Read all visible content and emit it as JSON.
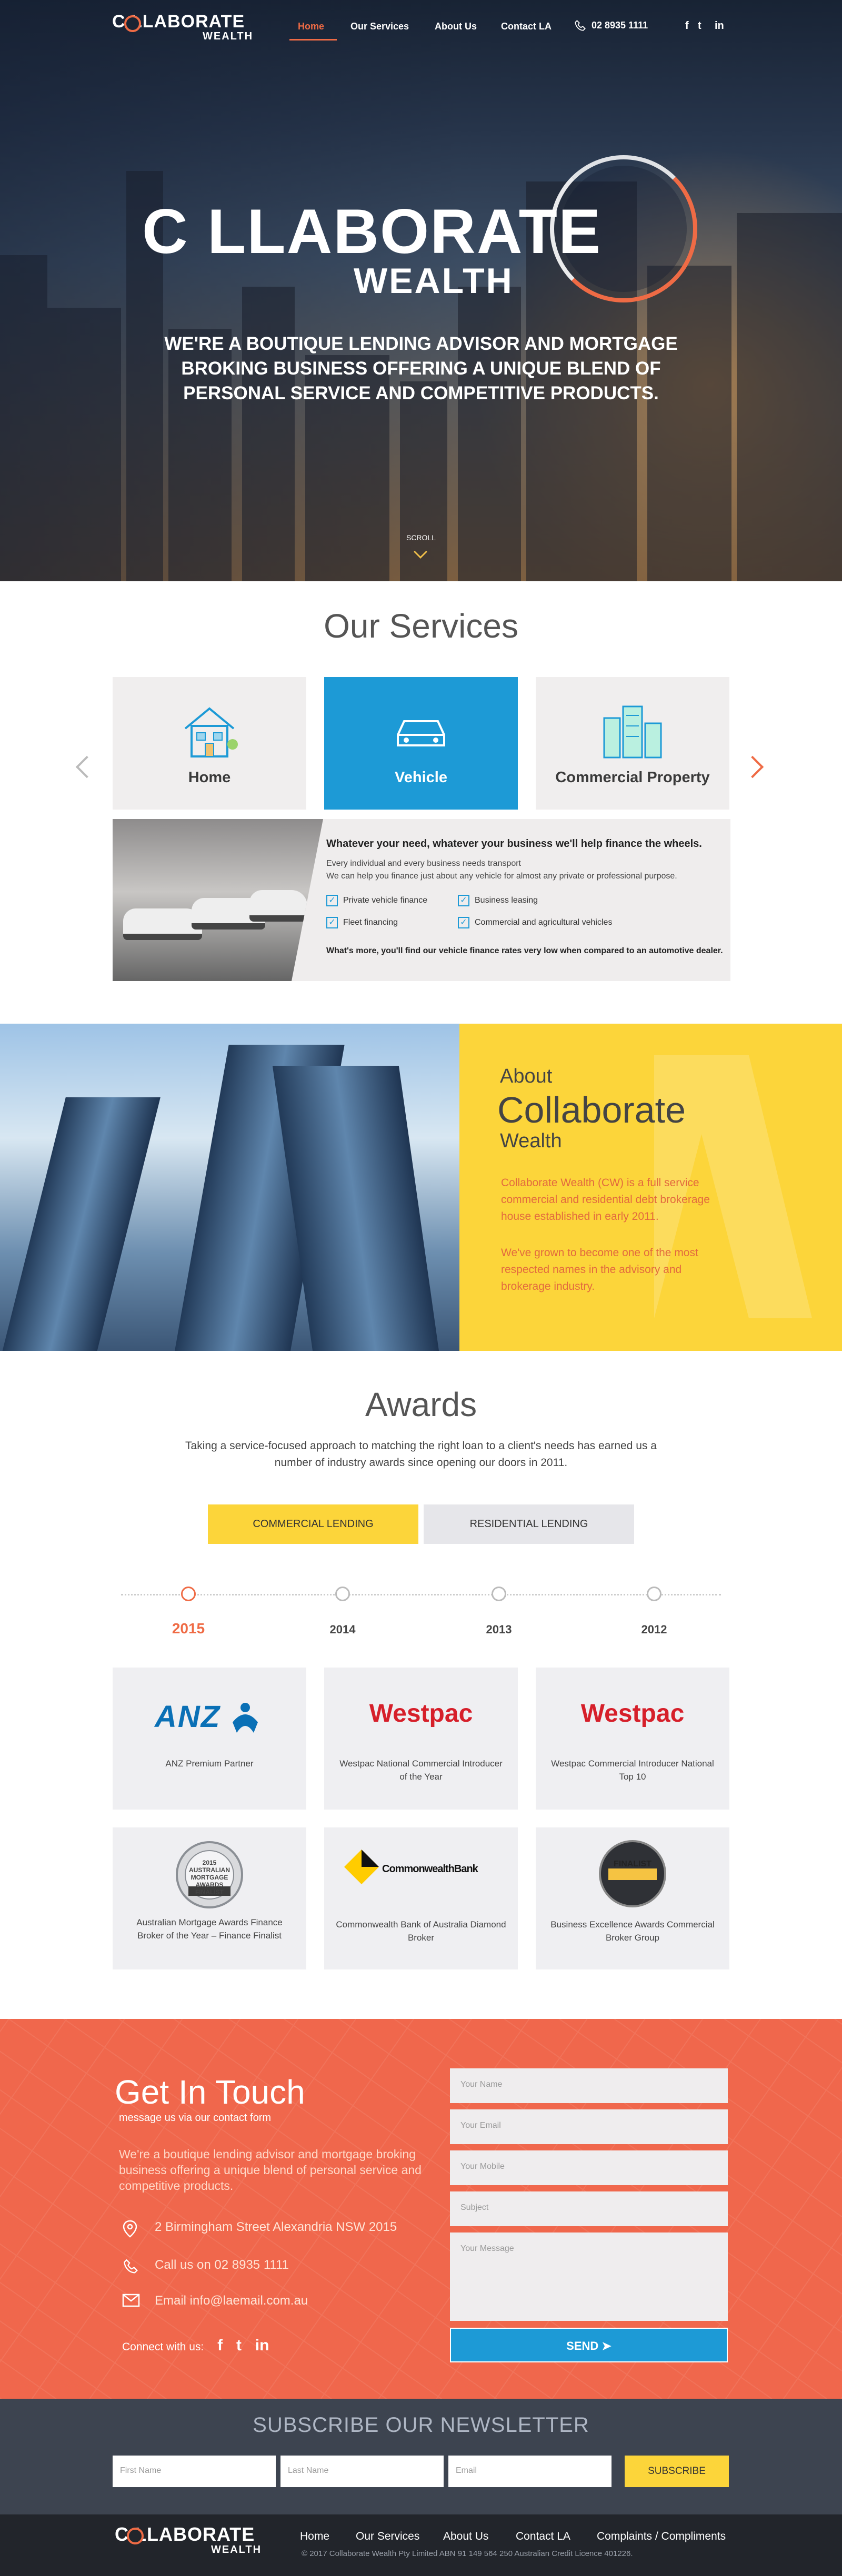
{
  "nav": {
    "logo_big": "C  LLABORATE",
    "logo_small": "WEALTH",
    "links": [
      "Home",
      "Our Services",
      "About Us",
      "Contact LA"
    ],
    "phone": "02 8935 1111",
    "social": [
      "f",
      "t",
      "in"
    ]
  },
  "hero": {
    "logo_big": "C  LLABORATE",
    "logo_small": "WEALTH",
    "tagline": "WE'RE A BOUTIQUE LENDING ADVISOR AND MORTGAGE BROKING BUSINESS OFFERING A UNIQUE BLEND OF PERSONAL SERVICE AND COMPETITIVE PRODUCTS.",
    "scroll": "SCROLL"
  },
  "services": {
    "title": "Our Services",
    "cards": [
      "Home",
      "Vehicle",
      "Commercial Property"
    ],
    "detail": {
      "heading": "Whatever your need, whatever your business we'll help finance the wheels.",
      "line1": "Every individual and every business needs transport",
      "line2": "We can help you finance just about any vehicle for almost any private or professional purpose.",
      "checks": [
        "Private vehicle finance",
        "Business leasing",
        "Fleet financing",
        "Commercial and agricultural vehicles"
      ],
      "footer": "What's more, you'll find our vehicle finance rates very low when compared to an automotive dealer."
    }
  },
  "about": {
    "l1": "About",
    "l2": "Collaborate",
    "l3": "Wealth",
    "p1": "Collaborate Wealth (CW) is a full service commercial and residential debt brokerage house established in early 2011.",
    "p2": "We've grown to become one of the most respected names in the advisory and brokerage industry."
  },
  "awards": {
    "title": "Awards",
    "intro": "Taking a service-focused approach to matching the right loan to a client's needs has earned us a number of industry awards since opening our doors in 2011.",
    "tabs": [
      "COMMERCIAL LENDING",
      "RESIDENTIAL LENDING"
    ],
    "years": [
      "2015",
      "2014",
      "2013",
      "2012"
    ],
    "cards": [
      {
        "logo": "ANZ",
        "caption": "ANZ Premium Partner"
      },
      {
        "logo": "Westpac",
        "caption": "Westpac National Commercial Introducer of the Year"
      },
      {
        "logo": "Westpac",
        "caption": "Westpac Commercial Introducer National Top 10"
      },
      {
        "logo": "2015 AUSTRALIAN MORTGAGE AWARDS FINALIST",
        "caption": "Australian Mortgage Awards Finance Broker of the Year – Finance Finalist"
      },
      {
        "logo": "CommonwealthBank",
        "caption": "Commonwealth Bank of Australia Diamond Broker"
      },
      {
        "logo": "FINALIST",
        "caption": "Business Excellence Awards Commercial Broker Group"
      }
    ]
  },
  "contact": {
    "title": "Get In Touch",
    "subtitle": "message us via our contact form",
    "intro": "We're a boutique lending advisor and mortgage broking business offering a unique blend of personal service and competitive products.",
    "address": "2 Birmingham Street Alexandria NSW 2015",
    "phone": "Call us on 02 8935 1111",
    "email": "Email info@laemail.com.au",
    "connect": "Connect with us:",
    "fields": [
      "Your Name",
      "Your Email",
      "Your Mobile",
      "Subject",
      "Your Message"
    ],
    "send": "SEND"
  },
  "newsletter": {
    "title": "SUBSCRIBE OUR  NEWSLETTER",
    "fields": [
      "First Name",
      "Last Name",
      "Email"
    ],
    "button": "SUBSCRIBE"
  },
  "footer": {
    "logo_big": "C  LLABORATE",
    "logo_small": "WEALTH",
    "links": [
      "Home",
      "Our Services",
      "About Us",
      "Contact LA",
      "Complaints / Compliments"
    ],
    "copyright": "© 2017 Collaborate Wealth Pty Limited ABN 91 149 564 250 Australian Credit Licence 401226."
  },
  "colors": {
    "accent": "#ef6b45",
    "blue": "#1d9ad6",
    "yellow": "#fcd53a",
    "dark": "#3d4450"
  }
}
